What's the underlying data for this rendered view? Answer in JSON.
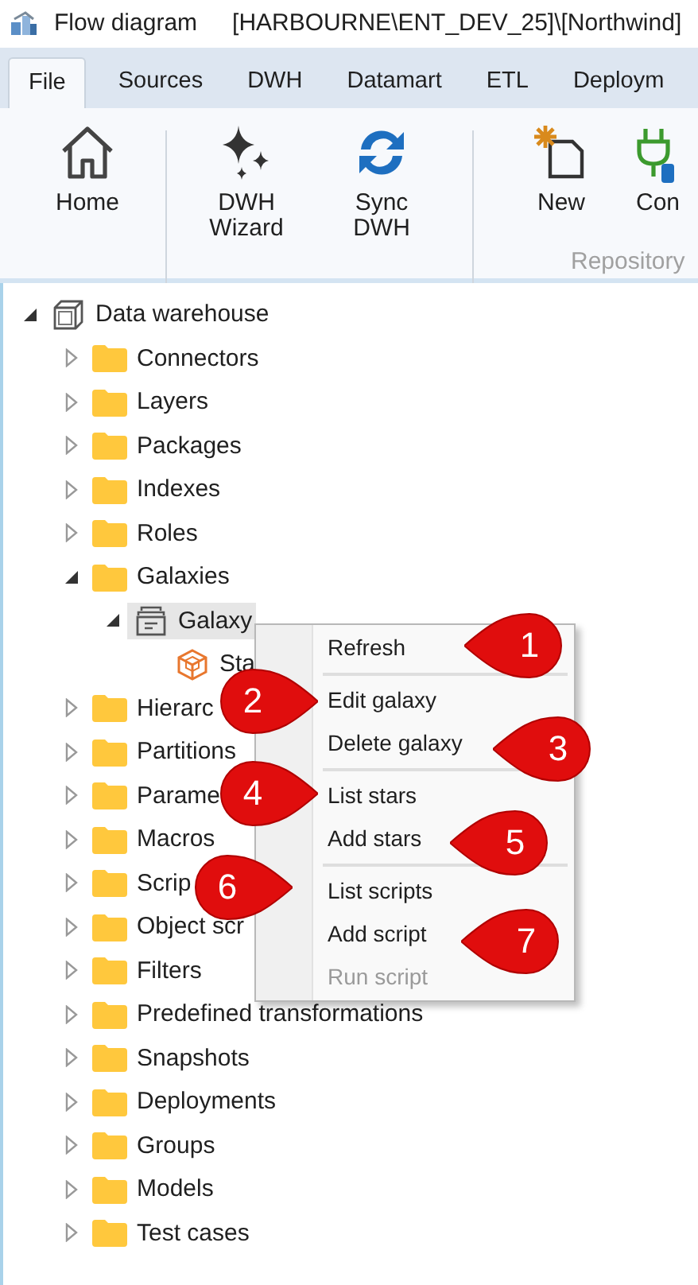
{
  "window": {
    "title": "Flow diagram",
    "connection": "[HARBOURNE\\ENT_DEV_25]\\[Northwind]"
  },
  "tabs": [
    {
      "label": "File",
      "selected": true
    },
    {
      "label": "Sources",
      "selected": false
    },
    {
      "label": "DWH",
      "selected": false
    },
    {
      "label": "Datamart",
      "selected": false
    },
    {
      "label": "ETL",
      "selected": false
    },
    {
      "label": "Deploym",
      "selected": false
    }
  ],
  "ribbon": {
    "buttons": [
      {
        "kind": "home",
        "label": "Home"
      },
      {
        "kind": "wizard",
        "label": "DWH Wizard"
      },
      {
        "kind": "sync",
        "label": "Sync DWH"
      },
      {
        "kind": "new",
        "label": "New"
      },
      {
        "kind": "connect",
        "label": "Con"
      }
    ],
    "group_label": "Repository"
  },
  "tree": [
    {
      "label": "Data warehouse",
      "kind": "warehouse",
      "expanded": true,
      "selected": false,
      "children": [
        {
          "label": "Connectors",
          "kind": "folder",
          "expanded": false,
          "selected": false
        },
        {
          "label": "Layers",
          "kind": "folder",
          "expanded": false,
          "selected": false
        },
        {
          "label": "Packages",
          "kind": "folder",
          "expanded": false,
          "selected": false
        },
        {
          "label": "Indexes",
          "kind": "folder",
          "expanded": false,
          "selected": false
        },
        {
          "label": "Roles",
          "kind": "folder",
          "expanded": false,
          "selected": false
        },
        {
          "label": "Galaxies",
          "kind": "folder",
          "expanded": true,
          "selected": false,
          "children": [
            {
              "label": "Galaxy",
              "kind": "galaxy",
              "expanded": true,
              "selected": true,
              "children": [
                {
                  "label": "Sta",
                  "kind": "star",
                  "selected": false
                }
              ]
            }
          ]
        },
        {
          "label": "Hierarc",
          "kind": "folder",
          "expanded": false,
          "selected": false
        },
        {
          "label": "Partitions",
          "kind": "folder",
          "expanded": false,
          "selected": false
        },
        {
          "label": "Parame",
          "kind": "folder",
          "expanded": false,
          "selected": false
        },
        {
          "label": "Macros",
          "kind": "folder",
          "expanded": false,
          "selected": false
        },
        {
          "label": "Scrip",
          "kind": "folder",
          "expanded": false,
          "selected": false
        },
        {
          "label": "Object scr",
          "kind": "folder",
          "expanded": false,
          "selected": false
        },
        {
          "label": "Filters",
          "kind": "folder",
          "expanded": false,
          "selected": false
        },
        {
          "label": "Predefined transformations",
          "kind": "folder",
          "expanded": false,
          "selected": false
        },
        {
          "label": "Snapshots",
          "kind": "folder",
          "expanded": false,
          "selected": false
        },
        {
          "label": "Deployments",
          "kind": "folder",
          "expanded": false,
          "selected": false
        },
        {
          "label": "Groups",
          "kind": "folder",
          "expanded": false,
          "selected": false
        },
        {
          "label": "Models",
          "kind": "folder",
          "expanded": false,
          "selected": false
        },
        {
          "label": "Test cases",
          "kind": "folder",
          "expanded": false,
          "selected": false
        }
      ]
    }
  ],
  "context_menu": {
    "groups": [
      [
        {
          "label": "Refresh",
          "disabled": false
        }
      ],
      [
        {
          "label": "Edit galaxy",
          "disabled": false
        },
        {
          "label": "Delete galaxy",
          "disabled": false
        }
      ],
      [
        {
          "label": "List stars",
          "disabled": false
        },
        {
          "label": "Add stars",
          "disabled": false
        }
      ],
      [
        {
          "label": "List scripts",
          "disabled": false
        },
        {
          "label": "Add script",
          "disabled": false
        },
        {
          "label": "Run script",
          "disabled": true
        }
      ]
    ]
  },
  "callouts": [
    {
      "number": "1"
    },
    {
      "number": "2"
    },
    {
      "number": "3"
    },
    {
      "number": "4"
    },
    {
      "number": "5"
    },
    {
      "number": "6"
    },
    {
      "number": "7"
    }
  ]
}
